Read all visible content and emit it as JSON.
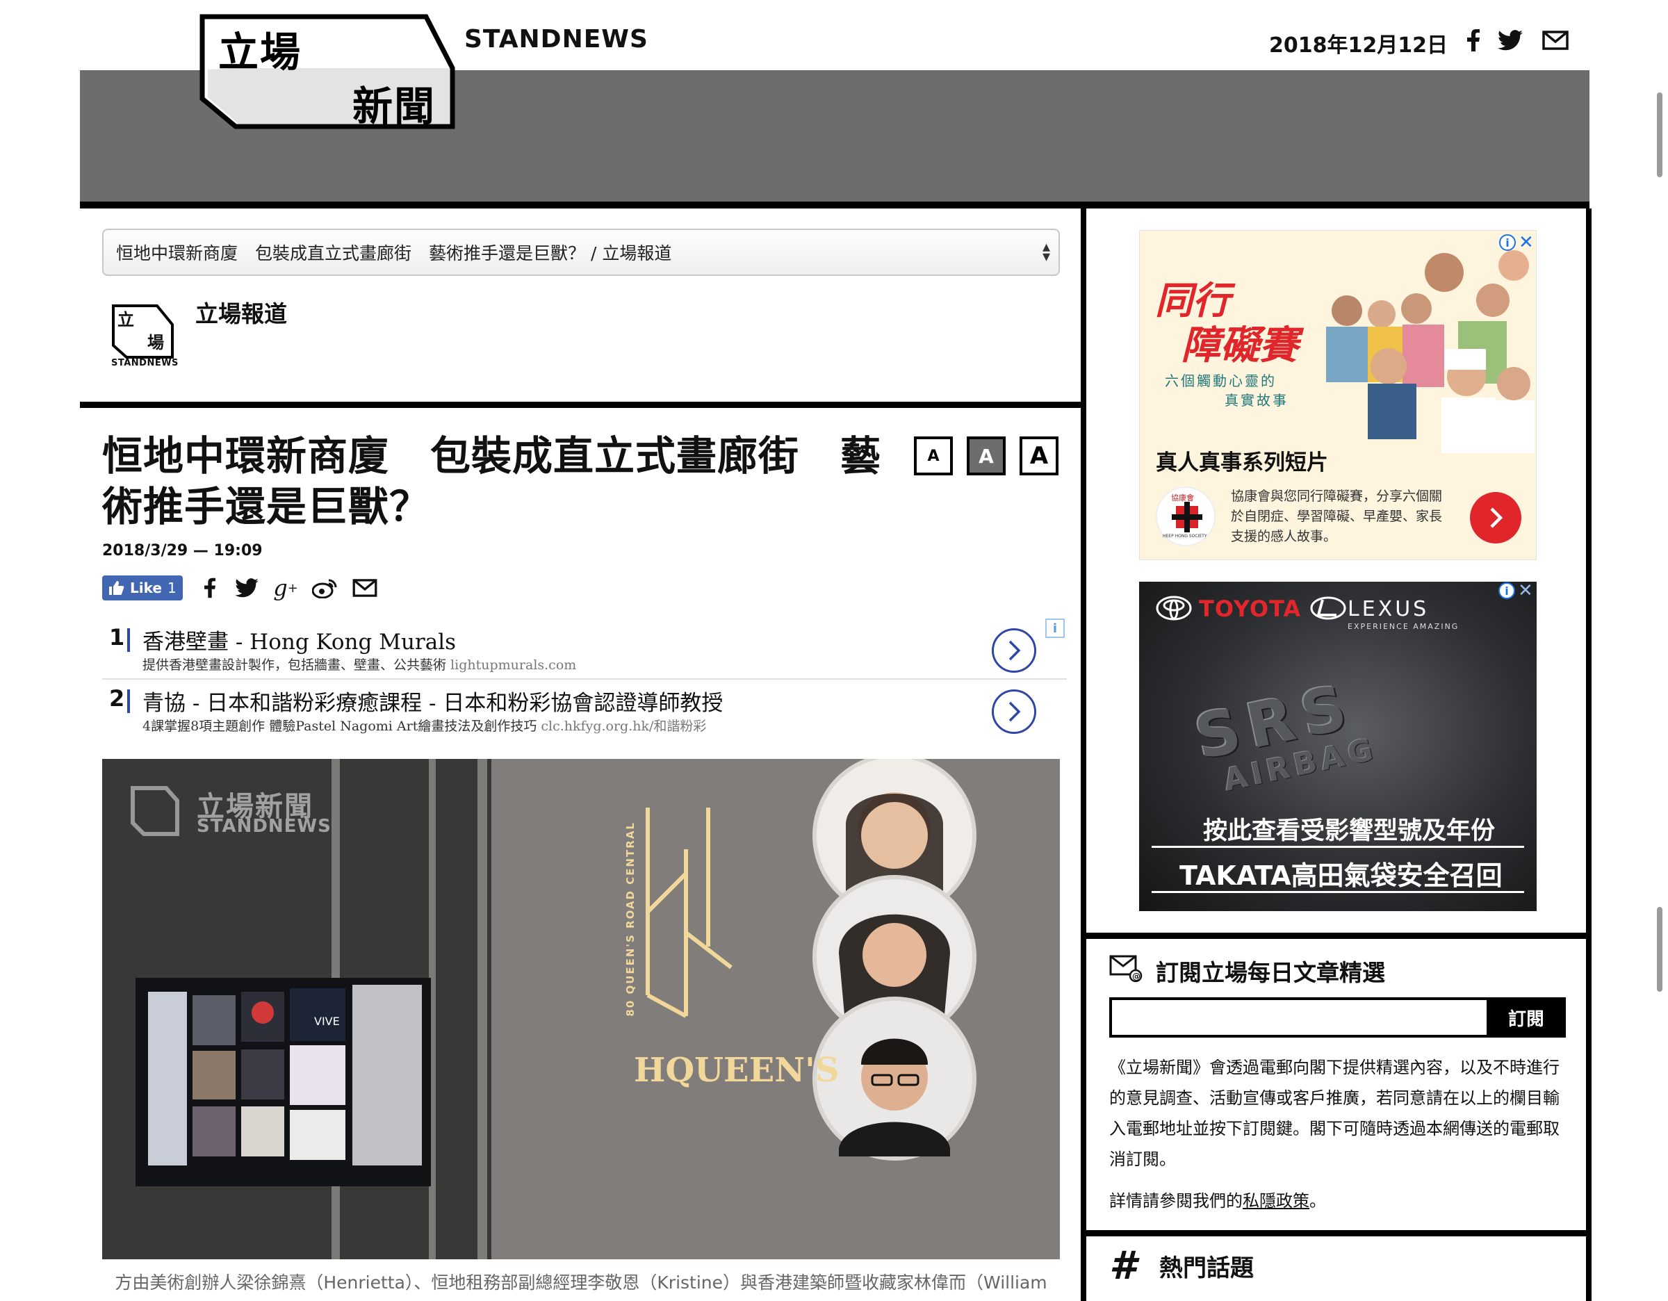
{
  "header": {
    "logo_line1": "立場",
    "logo_line2": "新聞",
    "brand": "STANDNEWS",
    "date": "2018年12月12日",
    "icons": [
      "facebook-icon",
      "twitter-icon",
      "mail-icon"
    ]
  },
  "article_selector": {
    "value": "恒地中環新商廈　包裝成直立式畫廊街　藝術推手還是巨獸？ / 立場報道"
  },
  "author": {
    "logo_line1": "立",
    "logo_line2": "場",
    "logo_label": "STANDNEWS",
    "name": "立場報道"
  },
  "article": {
    "title": "恒地中環新商廈　包裝成直立式畫廊街　藝術推手還是巨獸？",
    "date": "2018/3/29 — 19:09",
    "font_sizes": [
      "A",
      "A",
      "A"
    ],
    "like_label": "Like",
    "like_count": "1",
    "share_icons": [
      "facebook-icon",
      "twitter-icon",
      "google-plus-icon",
      "weibo-icon",
      "mail-icon"
    ],
    "hero_watermark_line1": "立場新聞",
    "hero_watermark_line2": "STANDNEWS",
    "hero_sign_text": "HQUEEN'S",
    "hero_sign_vertical": "80 QUEEN'S ROAD CENTRAL",
    "hero_screen_text": "VIVE",
    "caption": "方由美術創辦人梁徐錦熹（Henrietta）、恒地租務部副總經理李敬恩（Kristine）與香港建築師暨收藏家林偉而（William"
  },
  "sponsored_links": [
    {
      "num": "1",
      "title": "香港壁畫 - Hong Kong Murals",
      "desc": "提供香港壁畫設計製作，包括牆畫、壁畫、公共藝術",
      "domain": "lightupmurals.com"
    },
    {
      "num": "2",
      "title": "青協 - 日本和諧粉彩療癒課程 - 日本和粉彩協會認證導師教授",
      "desc": "4課掌握8項主題創作 體驗Pastel Nagomi Art繪畫技法及創作技巧",
      "domain": "clc.hkfyg.org.hk/和諧粉彩"
    }
  ],
  "sidebar": {
    "ad1": {
      "headline_1": "同行",
      "headline_2": "障礙賽",
      "sub_1": "六個觸動心靈的",
      "sub_2": "真實故事",
      "title": "真人真事系列短片",
      "body": "協康會與您同行障礙賽，分享六個關於自閉症、學習障礙、早產嬰、家長支援的感人故事。",
      "badge_text": "協康會",
      "badge_ring": "HEEP HONG SOCIETY"
    },
    "ad2": {
      "brand_1": "TOYOTA",
      "brand_2": "LEXUS",
      "tagline": "EXPERIENCE AMAZING",
      "emboss_1": "SRS",
      "emboss_2": "AIRBAG",
      "line1": "按此查看受影響型號及年份",
      "line2": "TAKATA高田氣袋安全召回"
    },
    "newsletter": {
      "title": "訂閱立場每日文章精選",
      "input_value": "",
      "button": "訂閱",
      "text": "《立場新聞》會透過電郵向閣下提供精選內容，以及不時進行的意見調查、活動宣傳或客戶推廣，若同意請在以上的欄目輸入電郵地址並按下訂閱鍵。閣下可隨時透過本網傳送的電郵取消訂閱。",
      "privacy_prefix": "詳情請參閱我們的",
      "privacy_link": "私隱政策",
      "privacy_suffix": "。"
    },
    "hot_topics": {
      "title": "熱門話題"
    }
  },
  "colors": {
    "header_grey": "#6d6d6d",
    "facebook_blue": "#4267b2",
    "ad_link_blue": "#2f46a8",
    "ad1_red": "#e0262b"
  }
}
